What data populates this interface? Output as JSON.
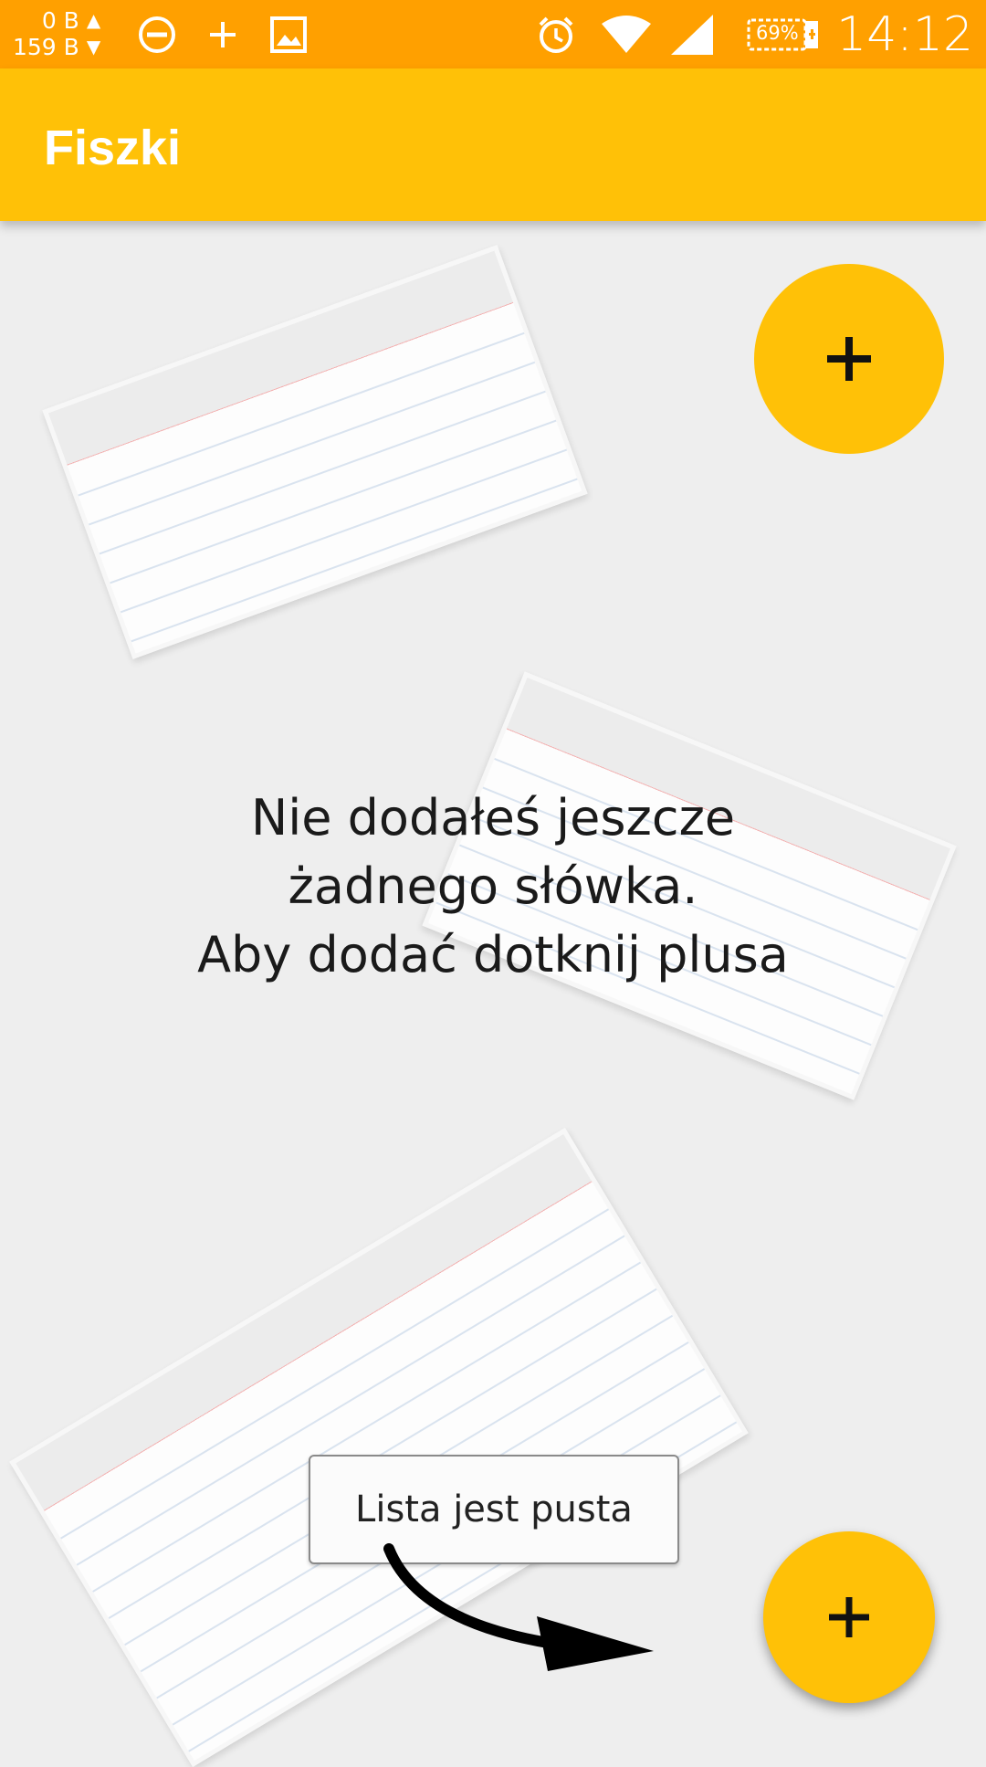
{
  "status_bar": {
    "upload": "0 B",
    "download": "159 B",
    "battery": "69%",
    "time": "14:12",
    "icons": [
      "dnd-icon",
      "plus-icon",
      "image-icon",
      "alarm-icon",
      "wifi-icon",
      "signal-icon",
      "battery-icon"
    ]
  },
  "app_bar": {
    "title": "Fiszki"
  },
  "empty_state": {
    "line1": "Nie dodałeś jeszcze",
    "line2": "żadnego słówka.",
    "line3": "Aby dodać dotknij plusa"
  },
  "toast": {
    "text": "Lista jest pusta"
  },
  "colors": {
    "status_bar": "#ffa000",
    "app_bar": "#ffc107",
    "fab": "#ffc107",
    "background": "#eeeeee"
  }
}
